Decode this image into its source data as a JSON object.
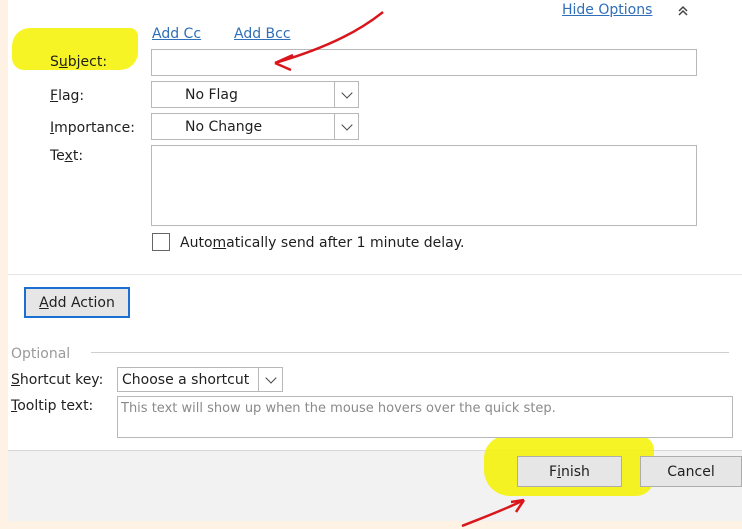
{
  "header": {
    "hide_options": "Hide Options"
  },
  "recipients": {
    "add_cc": "Add Cc",
    "add_bcc": "Add Bcc"
  },
  "fields": {
    "subject_prefix": "S",
    "subject_u": "u",
    "subject_rest": "bject:",
    "subject_value": "",
    "flag_u": "F",
    "flag_rest": "lag:",
    "flag_value": "No Flag",
    "importance_u": "I",
    "importance_rest": "mportance:",
    "importance_value": "No Change",
    "text_prefix": "Te",
    "text_u": "x",
    "text_rest": "t:",
    "text_value": ""
  },
  "auto_send": {
    "prefix": "Auto",
    "u": "m",
    "rest": "atically send after 1 minute delay."
  },
  "actions": {
    "add_action_u": "A",
    "add_action_rest": "dd Action"
  },
  "optional": {
    "legend": "Optional",
    "shortcut_u": "S",
    "shortcut_rest": "hortcut key:",
    "shortcut_value": "Choose a shortcut",
    "tooltip_u": "T",
    "tooltip_rest": "ooltip text:",
    "tooltip_placeholder": "This text will show up when the mouse hovers over the quick step."
  },
  "footer": {
    "finish_prefix": "F",
    "finish_u": "i",
    "finish_rest": "nish",
    "cancel": "Cancel"
  },
  "colors": {
    "highlight": "#f6f200",
    "annotation": "#d9161c",
    "link": "#2f6fb8",
    "focus": "#1a6fd1"
  }
}
